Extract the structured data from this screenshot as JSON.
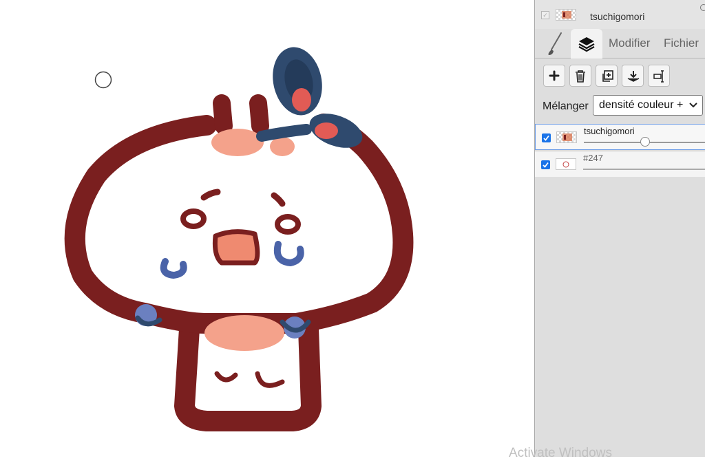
{
  "canvas": {
    "brush_cursor": "circle-cursor",
    "drawing": "tsuchigomori-character"
  },
  "panel": {
    "document": {
      "name": "tsuchigomori",
      "checked": true
    },
    "tabs": {
      "brush_icon": "brush-icon",
      "layers_icon": "layers-icon",
      "modifier": "Modifier",
      "fichier": "Fichier",
      "active": "layers"
    },
    "toolbar": [
      {
        "icon": "add-layer-icon"
      },
      {
        "icon": "trash-icon"
      },
      {
        "icon": "duplicate-layer-icon"
      },
      {
        "icon": "merge-down-icon"
      },
      {
        "icon": "transform-icon"
      }
    ],
    "blend": {
      "label": "Mélanger",
      "value": "densité couleur +"
    },
    "layers": [
      {
        "name": "tsuchigomori",
        "visible": true,
        "opacity": 0.5,
        "active": true
      },
      {
        "name": "#247",
        "visible": true,
        "active": false
      }
    ]
  },
  "watermark": "Activate Windows"
}
